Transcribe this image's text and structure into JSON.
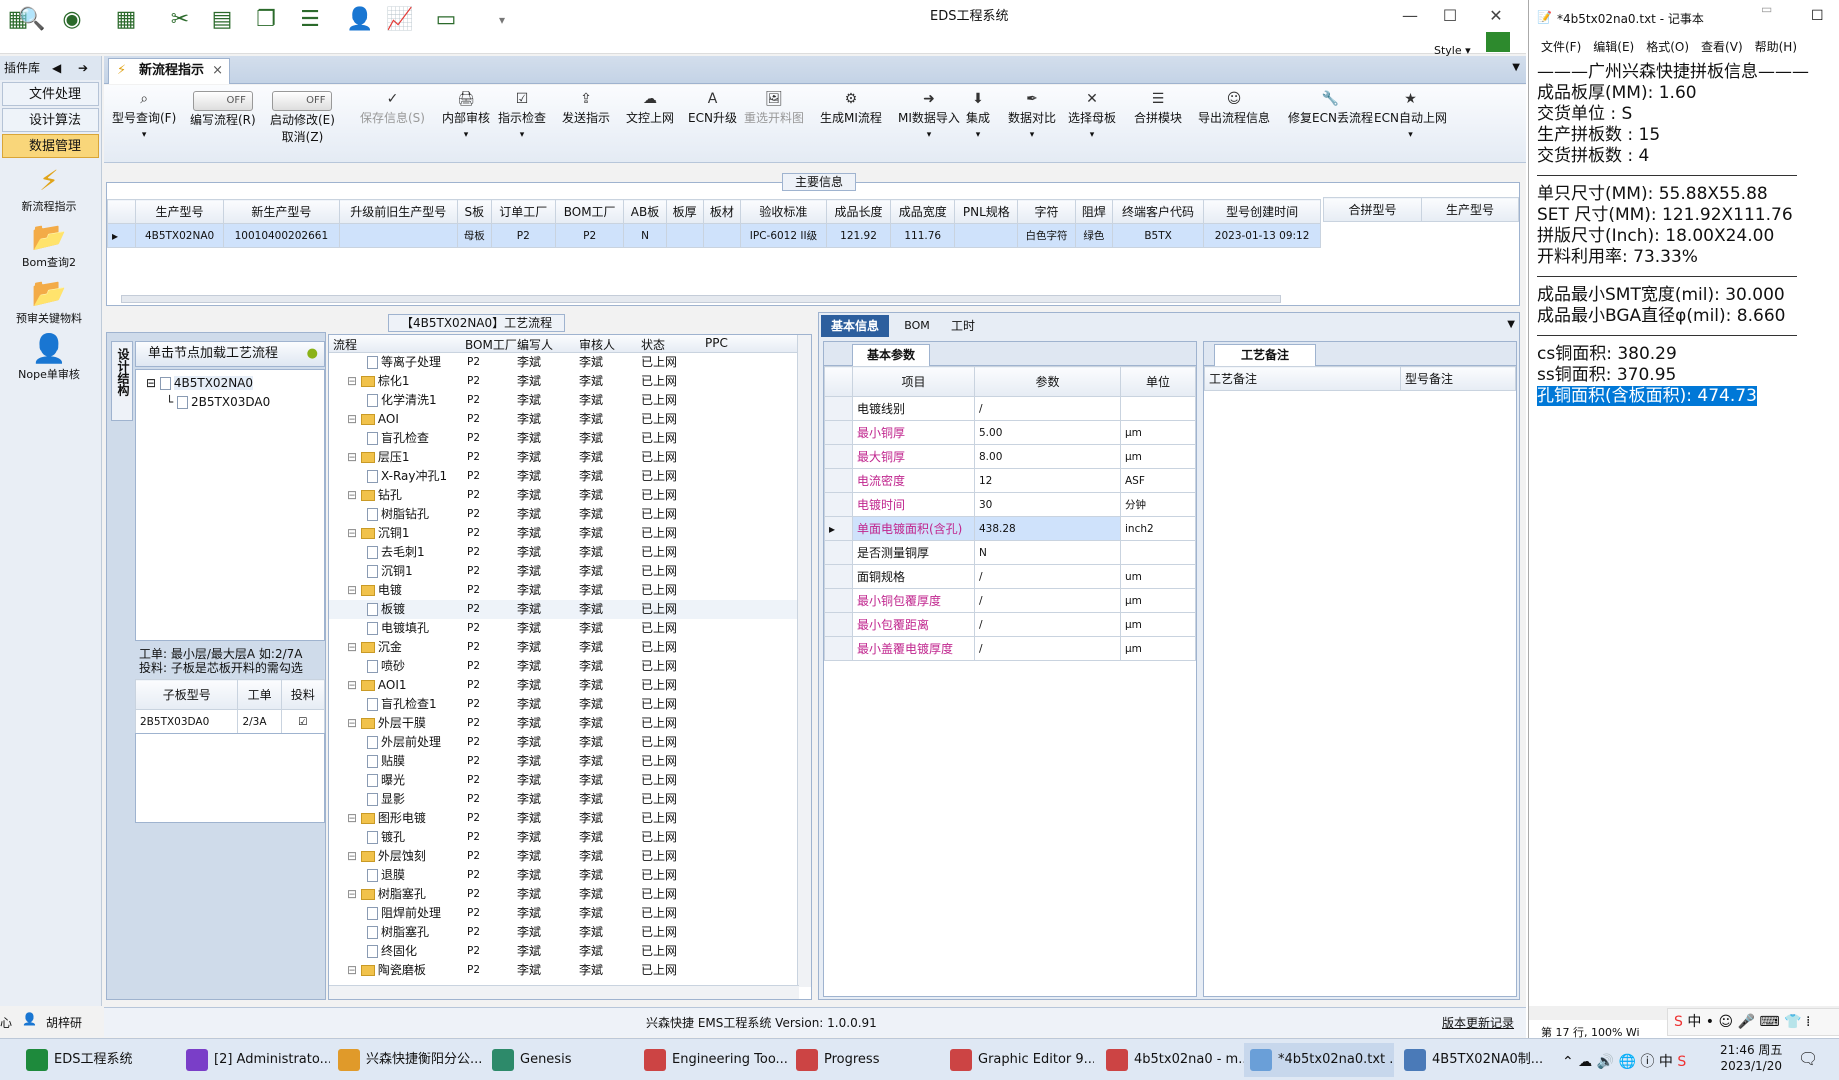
{
  "app": {
    "title": "EDS工程系统",
    "style_label": "Style"
  },
  "sidebar": {
    "header": "插件库",
    "items": [
      "文件处理",
      "设计算法",
      "数据管理"
    ],
    "big_items": [
      "新流程指示",
      "Bom查询2",
      "预审关键物料",
      "Nope单审核"
    ]
  },
  "tabs": {
    "active": "新流程指示"
  },
  "toolbar": {
    "buttons": [
      "型号查询(F)",
      "编写流程(R)",
      "启动修改(E)",
      "保存信息(S)",
      "内部审核",
      "指示检查",
      "发送指示",
      "文控上网",
      "ECN升级",
      "重选开料图",
      "生成MI流程",
      "MI数据导入",
      "集成",
      "数据对比",
      "选择母板",
      "合拼模块",
      "导出流程信息",
      "修复ECN丢流程",
      "ECN自动上网"
    ],
    "cancel_label": "取消(Z)",
    "toggle_off": "OFF"
  },
  "main_info": {
    "title": "主要信息",
    "headers": [
      "生产型号",
      "新生产型号",
      "升级前旧生产型号",
      "S板",
      "订单工厂",
      "BOM工厂",
      "AB板",
      "板厚",
      "板材",
      "验收标准",
      "成品长度",
      "成品宽度",
      "PNL规格",
      "字符",
      "阻焊",
      "终端客户代码",
      "型号创建时间"
    ],
    "row": [
      "4B5TX02NA0",
      "10010400202661",
      "",
      "母板",
      "P2",
      "P2",
      "N",
      "",
      "",
      "IPC-6012 II级",
      "121.92",
      "111.76",
      "",
      "白色字符",
      "绿色",
      "B5TX",
      "2023-01-13 09:12"
    ],
    "side_headers": [
      "合拼型号",
      "生产型号"
    ]
  },
  "process": {
    "title": "【4B5TX02NA0】工艺流程",
    "load_hint": "单击节点加载工艺流程",
    "side_tab": "设计结构",
    "tree": [
      "4B5TX02NA0",
      "2B5TX03DA0"
    ],
    "info_line1": "工单: 最小层/最大层A 如:2/7A",
    "info_line2": "投料: 子板是芯板开料的需勾选",
    "sub_headers": [
      "子板型号",
      "工单",
      "投料"
    ],
    "sub_row": [
      "2B5TX03DA0",
      "2/3A"
    ],
    "flow_headers": [
      "流程",
      "BOM工厂",
      "编写人",
      "审核人",
      "状态",
      "PPC"
    ],
    "flow_rows": [
      {
        "name": "等离子处理",
        "type": "doc",
        "lvl": 2
      },
      {
        "name": "棕化1",
        "type": "fold",
        "lvl": 1
      },
      {
        "name": "化学清洗1",
        "type": "doc",
        "lvl": 2
      },
      {
        "name": "AOI",
        "type": "fold",
        "lvl": 1
      },
      {
        "name": "盲孔检查",
        "type": "doc",
        "lvl": 2
      },
      {
        "name": "层压1",
        "type": "fold",
        "lvl": 1
      },
      {
        "name": "X-Ray冲孔1",
        "type": "doc",
        "lvl": 2
      },
      {
        "name": "钻孔",
        "type": "fold",
        "lvl": 1
      },
      {
        "name": "树脂钻孔",
        "type": "doc",
        "lvl": 2
      },
      {
        "name": "沉铜1",
        "type": "fold",
        "lvl": 1
      },
      {
        "name": "去毛刺1",
        "type": "doc",
        "lvl": 2
      },
      {
        "name": "沉铜1",
        "type": "doc",
        "lvl": 2
      },
      {
        "name": "电镀",
        "type": "fold",
        "lvl": 1
      },
      {
        "name": "板镀",
        "type": "doc",
        "lvl": 2
      },
      {
        "name": "电镀填孔",
        "type": "doc",
        "lvl": 2
      },
      {
        "name": "沉金",
        "type": "fold",
        "lvl": 1
      },
      {
        "name": "喷砂",
        "type": "doc",
        "lvl": 2
      },
      {
        "name": "AOI1",
        "type": "fold",
        "lvl": 1
      },
      {
        "name": "盲孔检查1",
        "type": "doc",
        "lvl": 2
      },
      {
        "name": "外层干膜",
        "type": "fold",
        "lvl": 1
      },
      {
        "name": "外层前处理",
        "type": "doc",
        "lvl": 2
      },
      {
        "name": "贴膜",
        "type": "doc",
        "lvl": 2
      },
      {
        "name": "曝光",
        "type": "doc",
        "lvl": 2
      },
      {
        "name": "显影",
        "type": "doc",
        "lvl": 2
      },
      {
        "name": "图形电镀",
        "type": "fold",
        "lvl": 1
      },
      {
        "name": "镀孔",
        "type": "doc",
        "lvl": 2
      },
      {
        "name": "外层蚀刻",
        "type": "fold",
        "lvl": 1
      },
      {
        "name": "退膜",
        "type": "doc",
        "lvl": 2
      },
      {
        "name": "树脂塞孔",
        "type": "fold",
        "lvl": 1
      },
      {
        "name": "阻焊前处理",
        "type": "doc",
        "lvl": 2
      },
      {
        "name": "树脂塞孔",
        "type": "doc",
        "lvl": 2
      },
      {
        "name": "终固化",
        "type": "doc",
        "lvl": 2
      },
      {
        "name": "陶瓷磨板",
        "type": "fold",
        "lvl": 1
      }
    ],
    "bom": "P2",
    "writer": "李斌",
    "reviewer": "李斌",
    "status": "已上网"
  },
  "right": {
    "tabs": [
      "基本信息",
      "BOM",
      "工时"
    ],
    "basic_title": "基本参数",
    "param_headers": [
      "项目",
      "参数",
      "单位"
    ],
    "params": [
      {
        "item": "电镀线别",
        "value": "/",
        "unit": "",
        "pink": false
      },
      {
        "item": "最小铜厚",
        "value": "5.00",
        "unit": "μm",
        "pink": true
      },
      {
        "item": "最大铜厚",
        "value": "8.00",
        "unit": "μm",
        "pink": true
      },
      {
        "item": "电流密度",
        "value": "12",
        "unit": "ASF",
        "pink": true
      },
      {
        "item": "电镀时间",
        "value": "30",
        "unit": "分钟",
        "pink": true
      },
      {
        "item": "单面电镀面积(含孔)",
        "value": "438.28",
        "unit": "inch2",
        "pink": true
      },
      {
        "item": "是否测量铜厚",
        "value": "N",
        "unit": "",
        "pink": false
      },
      {
        "item": "面铜规格",
        "value": "/",
        "unit": "um",
        "pink": false
      },
      {
        "item": "最小铜包覆厚度",
        "value": "/",
        "unit": "μm",
        "pink": true
      },
      {
        "item": "最小包覆距离",
        "value": "/",
        "unit": "μm",
        "pink": true
      },
      {
        "item": "最小盖覆电镀厚度",
        "value": "/",
        "unit": "μm",
        "pink": true
      }
    ],
    "remarks_title": "工艺备注",
    "remark_headers": [
      "工艺备注",
      "型号备注"
    ]
  },
  "status": {
    "user": "胡梓研",
    "version": "兴森快捷 EMS工程系统 Version: 1.0.0.91",
    "update": "版本更新记录",
    "left_char": "心"
  },
  "notepad": {
    "title": "*4b5tx02na0.txt - 记事本",
    "menu": [
      "文件(F)",
      "编辑(E)",
      "格式(O)",
      "查看(V)",
      "帮助(H)"
    ],
    "lines1": [
      "———广州兴森快捷拼板信息———",
      "成品板厚(MM): 1.60",
      "交货单位 : S",
      "生产拼板数 : 15",
      "交货拼板数 : 4"
    ],
    "lines2": [
      "单只尺寸(MM): 55.88X55.88",
      "SET 尺寸(MM): 121.92X111.76",
      "拼版尺寸(Inch): 18.00X24.00",
      "开料利用率: 73.33%"
    ],
    "lines3": [
      "成品最小SMT宽度(mil): 30.000",
      "成品最小BGA直径φ(mil):  8.660"
    ],
    "lines4": [
      "cs铜面积: 380.29",
      "ss铜面积: 370.95"
    ],
    "selected": "孔铜面积(含板面积): 474.73",
    "status": "第 17 行, 100%  Wi"
  },
  "taskbar": {
    "items": [
      "EDS工程系统",
      "[2] Administrato...",
      "兴森快捷衡阳分公...",
      "Genesis",
      "Engineering Too...",
      "Progress",
      "Graphic Editor 9...",
      "4b5tx02na0 - m...",
      "*4b5tx02na0.txt ...",
      "4B5TX02NA0制..."
    ],
    "time": "21:46 周五",
    "date": "2023/1/20",
    "ime": "中"
  }
}
